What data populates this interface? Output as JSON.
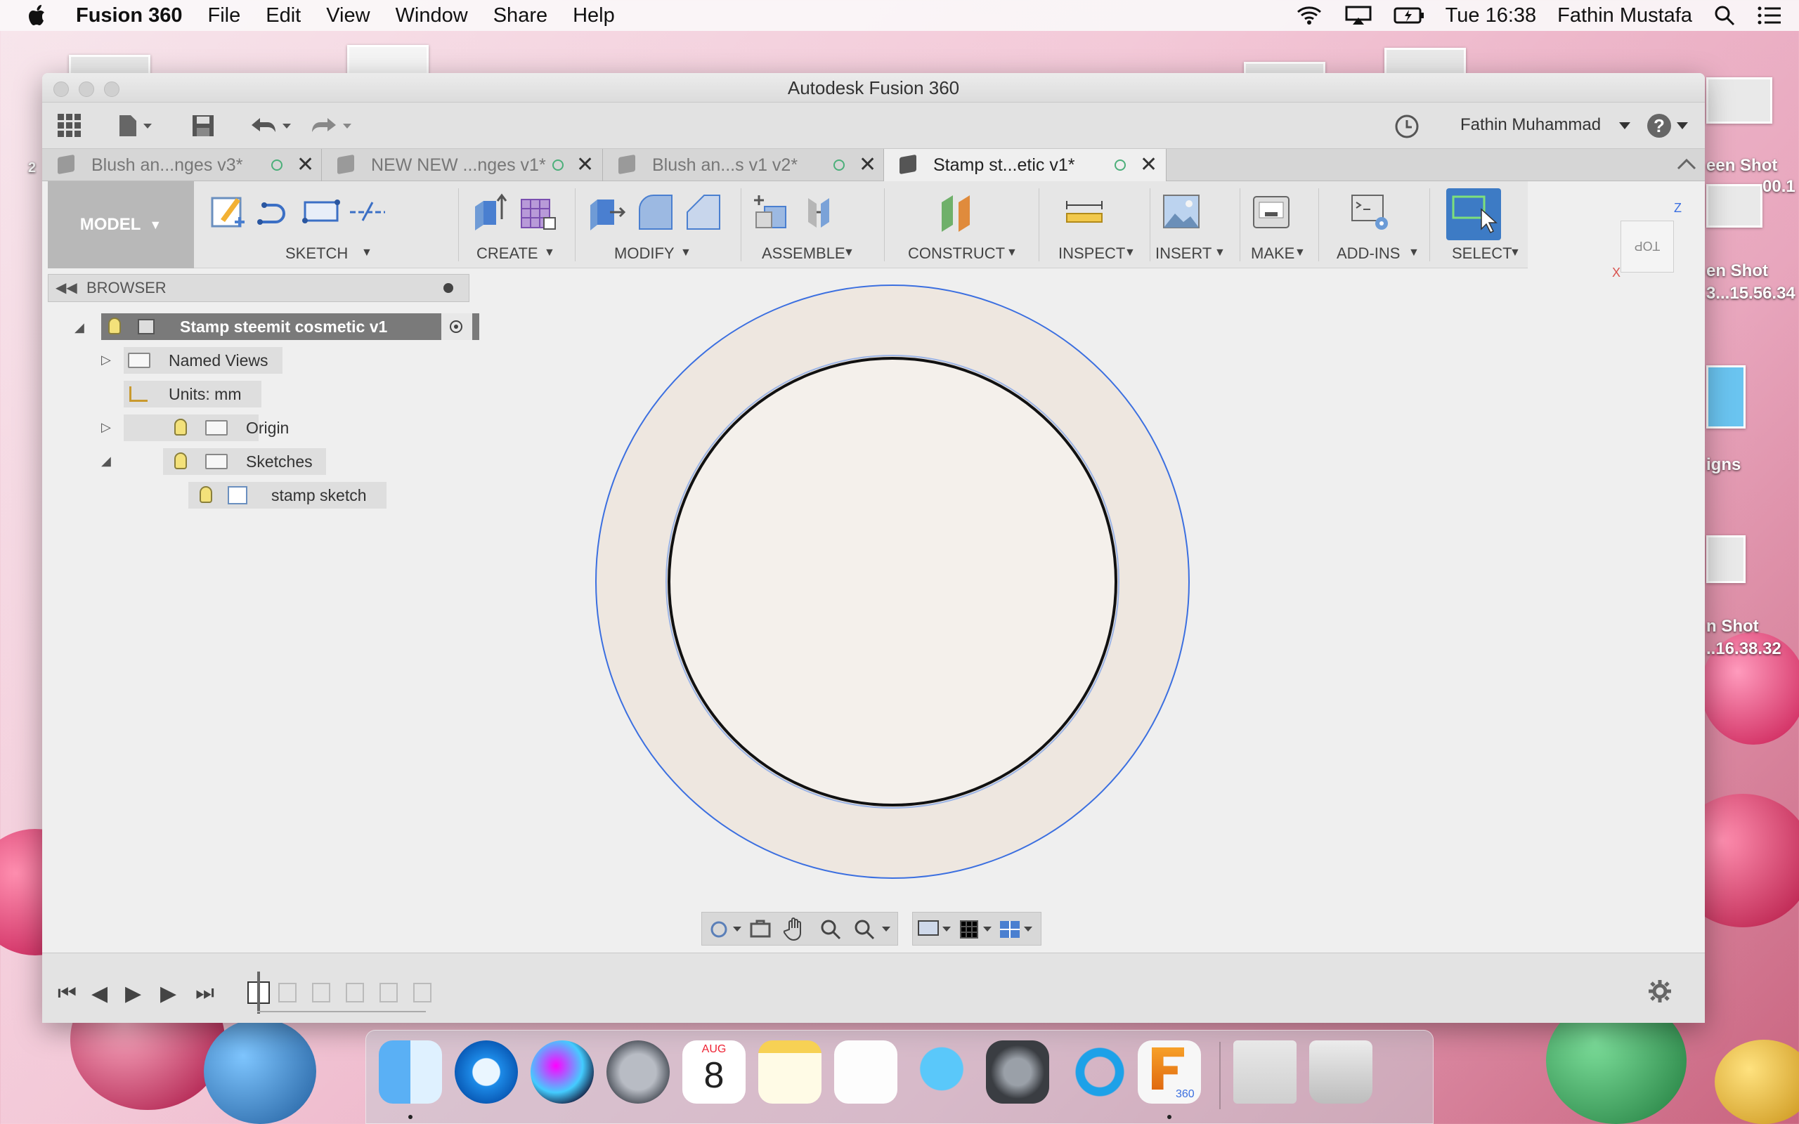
{
  "menubar": {
    "apple": "",
    "app_name": "Fusion 360",
    "items": [
      "File",
      "Edit",
      "View",
      "Window",
      "Share",
      "Help"
    ],
    "clock": "Tue 16:38",
    "user": "Fathin Mustafa"
  },
  "desktop": {
    "labels": [
      "een Shot",
      "00.1",
      "en Shot",
      "3...15.56.34",
      "igns",
      "n Shot",
      "..16.38.32"
    ],
    "stray": "2"
  },
  "window": {
    "title": "Autodesk Fusion 360",
    "account": "Fathin Muhammad",
    "help_icon": "?"
  },
  "tabs": [
    {
      "label": "Blush an...nges v3*",
      "active": false
    },
    {
      "label": "NEW NEW ...nges v1*",
      "active": false
    },
    {
      "label": "Blush an...s v1 v2*",
      "active": false
    },
    {
      "label": "Stamp st...etic v1*",
      "active": true
    }
  ],
  "toolbar": {
    "workspace": "MODEL",
    "groups": [
      "SKETCH",
      "CREATE",
      "MODIFY",
      "ASSEMBLE",
      "CONSTRUCT",
      "INSPECT",
      "INSERT",
      "MAKE",
      "ADD-INS",
      "SELECT"
    ]
  },
  "viewcube": {
    "face": "TOP",
    "axis_z": "Z",
    "axis_x": "X"
  },
  "browser": {
    "title": "BROWSER",
    "root": "Stamp steemit cosmetic v1",
    "nodes": [
      "Named Views",
      "Units: mm",
      "Origin",
      "Sketches",
      "stamp sketch"
    ]
  },
  "dock": {
    "calendar_month": "AUG",
    "calendar_day": "8",
    "fusion_badge": "360"
  },
  "colors": {
    "accent": "#4a7fd0",
    "select_active": "#3d7bc5",
    "outer_ring": "#3b6fe0",
    "ring_fill": "#eee7e0"
  }
}
